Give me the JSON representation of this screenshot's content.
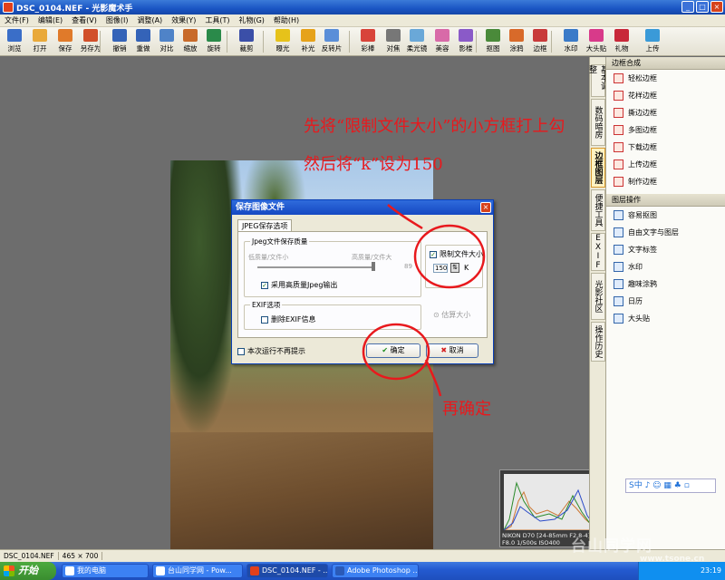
{
  "window": {
    "title": "DSC_0104.NEF - 光影魔术手"
  },
  "menu": [
    "文件(F)",
    "编辑(E)",
    "查看(V)",
    "图像(I)",
    "调整(A)",
    "效果(Y)",
    "工具(T)",
    "礼物(G)",
    "帮助(H)"
  ],
  "toolbar": [
    {
      "label": "浏览",
      "icon": "browse-icon",
      "color": "#3a6ec8"
    },
    {
      "label": "打开",
      "icon": "open-folder-icon",
      "color": "#e9a93a"
    },
    {
      "label": "保存",
      "icon": "save-icon",
      "color": "#e07a2a"
    },
    {
      "label": "另存为",
      "icon": "save-as-icon",
      "color": "#d14f2a"
    },
    {
      "label": "撤销",
      "icon": "undo-icon",
      "color": "#3463b8"
    },
    {
      "label": "重做",
      "icon": "redo-icon",
      "color": "#3463b8"
    },
    {
      "label": "对比",
      "icon": "compare-icon",
      "color": "#4f83c8"
    },
    {
      "label": "缩放",
      "icon": "zoom-icon",
      "color": "#c86a2a"
    },
    {
      "label": "旋转",
      "icon": "rotate-icon",
      "color": "#2a8a4a"
    },
    {
      "label": "裁剪",
      "icon": "crop-icon",
      "color": "#3b4fa8"
    },
    {
      "label": "曝光",
      "icon": "exposure-icon",
      "color": "#e6c21a"
    },
    {
      "label": "补光",
      "icon": "fill-light-icon",
      "color": "#e6a21a"
    },
    {
      "label": "反转片",
      "icon": "slide-film-icon",
      "color": "#5a8ed8"
    },
    {
      "label": "彩棒",
      "icon": "color-stick-icon",
      "color": "#d8443a"
    },
    {
      "label": "对焦",
      "icon": "focus-icon",
      "color": "#777777"
    },
    {
      "label": "柔光镜",
      "icon": "soft-light-icon",
      "color": "#6aa8d8"
    },
    {
      "label": "美容",
      "icon": "beauty-icon",
      "color": "#d86aa8"
    },
    {
      "label": "影楼",
      "icon": "studio-icon",
      "color": "#8a5ac8"
    },
    {
      "label": "抠图",
      "icon": "cutout-icon",
      "color": "#4a8a3a"
    },
    {
      "label": "涂鸦",
      "icon": "doodle-icon",
      "color": "#d86a2a"
    },
    {
      "label": "边框",
      "icon": "border-icon",
      "color": "#c83a3a"
    },
    {
      "label": "水印",
      "icon": "watermark-icon",
      "color": "#3a7ac8"
    },
    {
      "label": "大头贴",
      "icon": "sticker-icon",
      "color": "#d83a8a"
    },
    {
      "label": "礼物",
      "icon": "gift-icon",
      "color": "#c8283a"
    },
    {
      "label": "上传",
      "icon": "upload-icon",
      "color": "#3a9ad8"
    }
  ],
  "side_tabs": [
    "基本调整",
    "数码暗房",
    "边框图层",
    "便捷工具",
    "EXIF",
    "光影社区",
    "操作历史"
  ],
  "panels": {
    "border": {
      "title": "边框合成",
      "items": [
        "轻松边框",
        "花样边框",
        "撕边边框",
        "多图边框",
        "下载边框",
        "上传边框",
        "制作边框"
      ]
    },
    "layer": {
      "title": "图层操作",
      "items": [
        "容易抠图",
        "自由文字与图层",
        "文字标签",
        "水印",
        "趣味涂鸦",
        "日历",
        "大头贴"
      ]
    }
  },
  "ime_bar": "S中 ♪ ☺ ▦ ♣ ▫",
  "histogram": {
    "camera": "NIKON D70",
    "lens": "[24-85mm F2.8-4]",
    "exposure": "F8.0  1/500s  ISO400"
  },
  "annotations": {
    "line1": "先将“限制文件大小”的小方框打上勾",
    "line2": "然后将“k”设为150",
    "line3": "再确定"
  },
  "dialog": {
    "title": "保存图像文件",
    "tab": "JPEG保存选项",
    "quality_group": "Jpeg文件保存质量",
    "low_label": "低质量/文件小",
    "high_label": "高质量/文件大",
    "quality_value": "89",
    "high_quality_output": "采用高质量Jpeg输出",
    "limit_size_label": "限制文件大小",
    "size_value": "150",
    "size_unit": "K",
    "exif_group": "EXIF选项",
    "delete_exif": "删除EXIF信息",
    "estimate": "估算大小",
    "dont_show": "本次运行不再提示",
    "ok": "确定",
    "cancel": "取消"
  },
  "status": {
    "filename": "DSC_0104.NEF",
    "size": "465 × 700"
  },
  "taskbar": {
    "start": "开始",
    "tasks": [
      "我的电脑",
      "台山同学网 - Pow...",
      "DSC_0104.NEF - ...",
      "Adobe Photoshop ..."
    ],
    "clock": "23:19",
    "watermark": "台山同学网",
    "watermark_url": "www.tsone.cn"
  }
}
